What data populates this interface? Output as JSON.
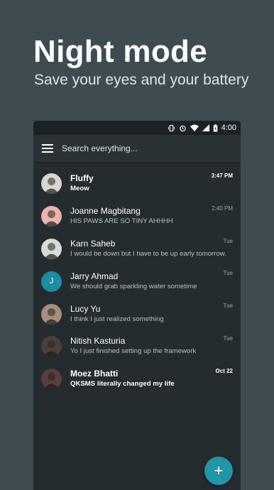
{
  "promo": {
    "title": "Night mode",
    "subtitle": "Save your eyes and your battery"
  },
  "status_bar": {
    "time": "4:00",
    "icons": [
      "vibrate-icon",
      "alarm-icon",
      "wifi-icon",
      "signal-icon",
      "battery-charging-icon"
    ]
  },
  "toolbar": {
    "menu_icon": "hamburger-menu-icon",
    "search_placeholder": "Search everything..."
  },
  "conversations": [
    {
      "name": "Fluffy",
      "snippet": "Meow",
      "time": "3:47 PM",
      "unread": true,
      "avatar": "photo",
      "avatar_color": "#d8d6d0"
    },
    {
      "name": "Joanne Magbitang",
      "snippet": "HIS PAWS ARE SO TINY AHHHH",
      "time": "2:40 PM",
      "unread": false,
      "avatar": "photo",
      "avatar_color": "#e8b4ad"
    },
    {
      "name": "Karn Saheb",
      "snippet": "I would be down but I have to be up early tomorrow.",
      "time": "Tue",
      "unread": false,
      "avatar": "photo",
      "avatar_color": "#d9dbd8"
    },
    {
      "name": "Jarry Ahmad",
      "snippet": "We should grab sparkling water sometime",
      "time": "Tue",
      "unread": false,
      "avatar": "J",
      "avatar_color": "#1a8ea3"
    },
    {
      "name": "Lucy Yu",
      "snippet": "I think I just realized something",
      "time": "Tue",
      "unread": false,
      "avatar": "photo",
      "avatar_color": "#a98e7c"
    },
    {
      "name": "Nitish Kasturia",
      "snippet": "Yo I just finished setting up the framework",
      "time": "Tue",
      "unread": false,
      "avatar": "photo",
      "avatar_color": "#4a4039"
    },
    {
      "name": "Moez Bhatti",
      "snippet": "QKSMS literally changed my life",
      "time": "Oct 22",
      "unread": true,
      "avatar": "photo",
      "avatar_color": "#5a3d3f"
    }
  ],
  "fab": {
    "icon": "plus-icon",
    "label": "+"
  },
  "colors": {
    "background": "#3e4c52",
    "surface": "#242c30",
    "toolbar": "#2a3236",
    "statusbar": "#1b2124",
    "accent": "#2196a6"
  }
}
